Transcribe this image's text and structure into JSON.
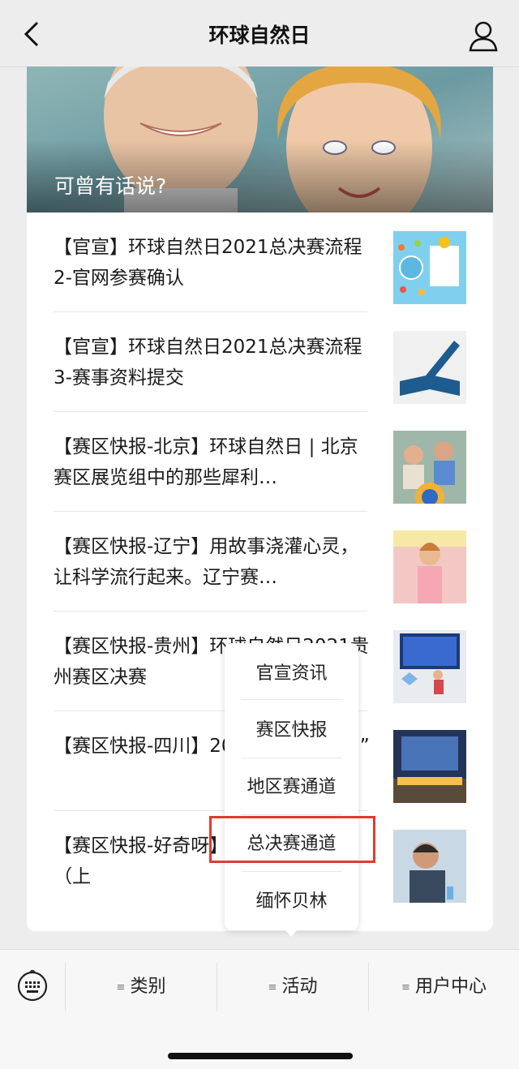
{
  "nav": {
    "title": "环球自然日"
  },
  "banner": {
    "caption": "可曾有话说?"
  },
  "articles": [
    {
      "title": "【官宣】环球自然日2021总决赛流程 2-官网参赛确认"
    },
    {
      "title": "【官宣】环球自然日2021总决赛流程 3-赛事资料提交"
    },
    {
      "title": "【赛区快报-北京】环球自然日 | 北京赛区展览组中的那些犀利…"
    },
    {
      "title": "【赛区快报-辽宁】用故事浇灌心灵，让科学流行起来。辽宁赛…"
    },
    {
      "title": "【赛区快报-贵州】环球自然日2021贵州赛区决赛"
    },
    {
      "title": "【赛区快报-四川】2021“环球自然日”"
    },
    {
      "title": "【赛区快报-好奇呀】日科学展演赛（上"
    }
  ],
  "popup_menu": {
    "items": [
      "官宣资讯",
      "赛区快报",
      "地区赛通道",
      "总决赛通道",
      "缅怀贝林"
    ],
    "highlighted": "总决赛通道"
  },
  "bottom_tabs": [
    "类别",
    "活动",
    "用户中心"
  ],
  "colors": {
    "highlight": "#e33a2f",
    "background": "#ededed"
  }
}
